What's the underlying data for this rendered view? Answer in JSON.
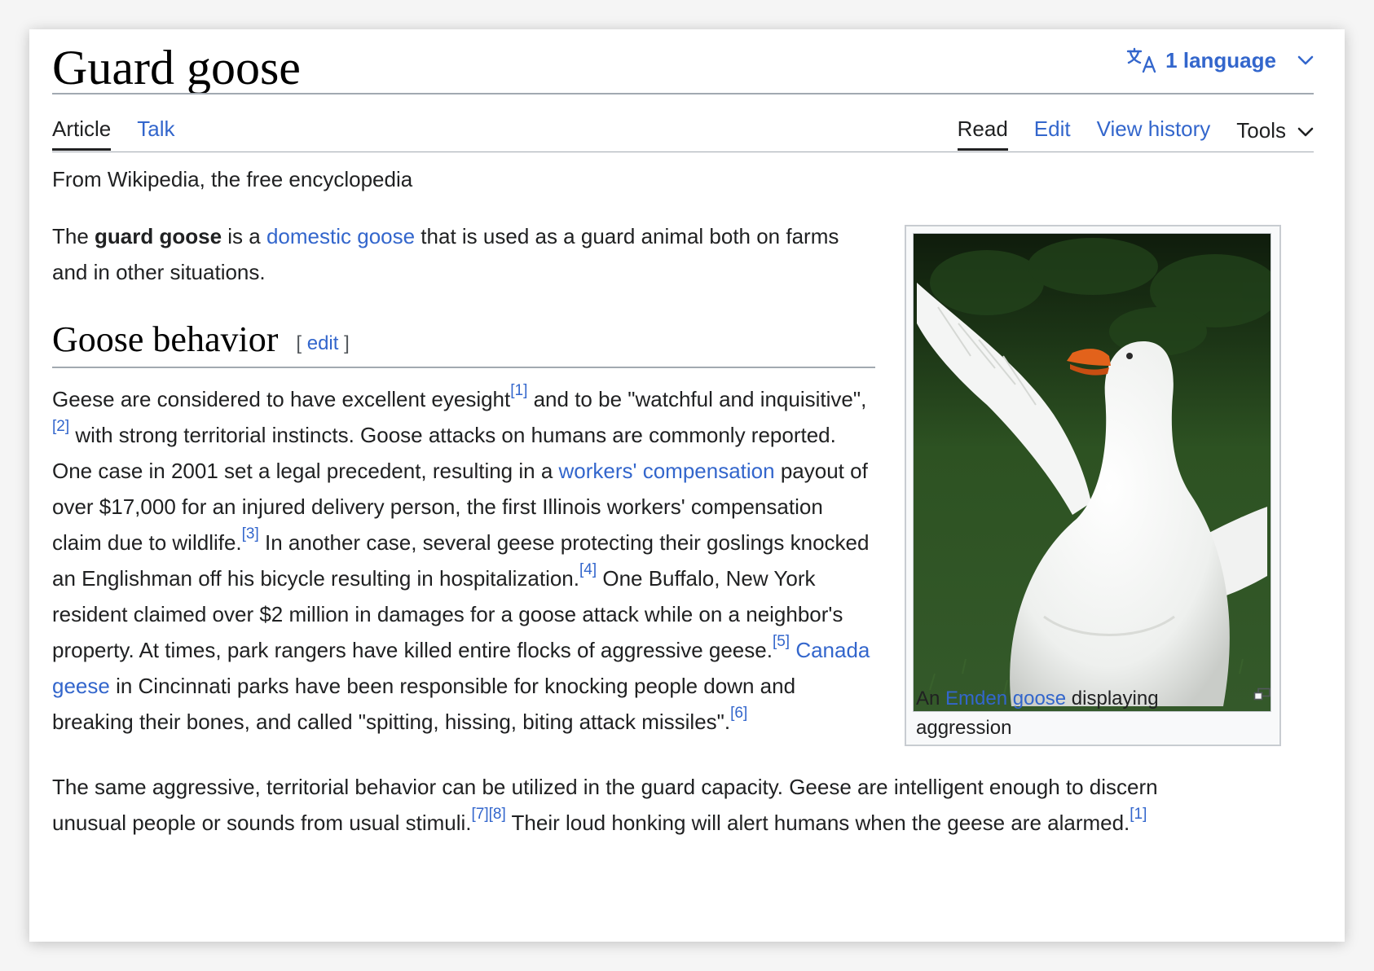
{
  "page": {
    "title": "Guard goose",
    "languages_label": "1 language",
    "tagline": "From Wikipedia, the free encyclopedia"
  },
  "tabs": {
    "article": "Article",
    "talk": "Talk",
    "read": "Read",
    "edit": "Edit",
    "view_history": "View history",
    "tools": "Tools"
  },
  "intro": {
    "t1": "The ",
    "bold": "guard goose",
    "t2": " is a ",
    "link_domestic_goose": "domestic goose",
    "t3": " that is used as a guard animal both on farms and in other situations."
  },
  "section": {
    "heading": "Goose behavior",
    "edit_open": "[ ",
    "edit_label": "edit",
    "edit_close": " ]"
  },
  "para2": {
    "s1": "Geese are considered to have excellent eyesight",
    "ref1": "[1]",
    "s2": " and to be \"watchful and inquisitive\",",
    "ref2": "[2]",
    "s3": " with strong territorial instincts. Goose attacks on humans are commonly reported. One case in 2001 set a legal precedent, resulting in a ",
    "link_workers": "workers' compensation",
    "s4": " payout of over $17,000 for an injured delivery person, the first Illinois workers' compensation claim due to wildlife.",
    "ref3": "[3]",
    "s5": " In another case, several geese protecting their goslings knocked an Englishman off his bicycle resulting in hospitalization.",
    "ref4": "[4]",
    "s6": " One Buffalo, New York resident claimed over $2 million in damages for a goose attack while on a neighbor's property. At times, park rangers have killed entire flocks of aggressive geese.",
    "ref5": "[5]",
    "s7": " ",
    "link_canada": "Canada geese",
    "s8": " in Cincinnati parks have been responsible for knocking people down and breaking their bones, and called \"spitting, hissing, biting attack missiles\".",
    "ref6": "[6]"
  },
  "para3": {
    "s1": "The same aggressive, territorial behavior can be utilized in the guard capacity. Geese are intelligent enough to discern unusual people or sounds from usual stimuli.",
    "ref7": "[7]",
    "ref8": "[8]",
    "s2": " Their loud honking will alert humans when the geese are alarmed.",
    "ref1": "[1]"
  },
  "infobox": {
    "caption_pre": "An ",
    "caption_link": "Emden goose",
    "caption_post": " displaying aggression"
  },
  "colors": {
    "link": "#3366cc",
    "text": "#202122",
    "border": "#a2a9b1",
    "infobox_bg": "#f8f9fa"
  },
  "icons": {
    "language": "translate-icon",
    "dropdown": "chevron-down-icon",
    "enlarge": "enlarge-icon"
  }
}
